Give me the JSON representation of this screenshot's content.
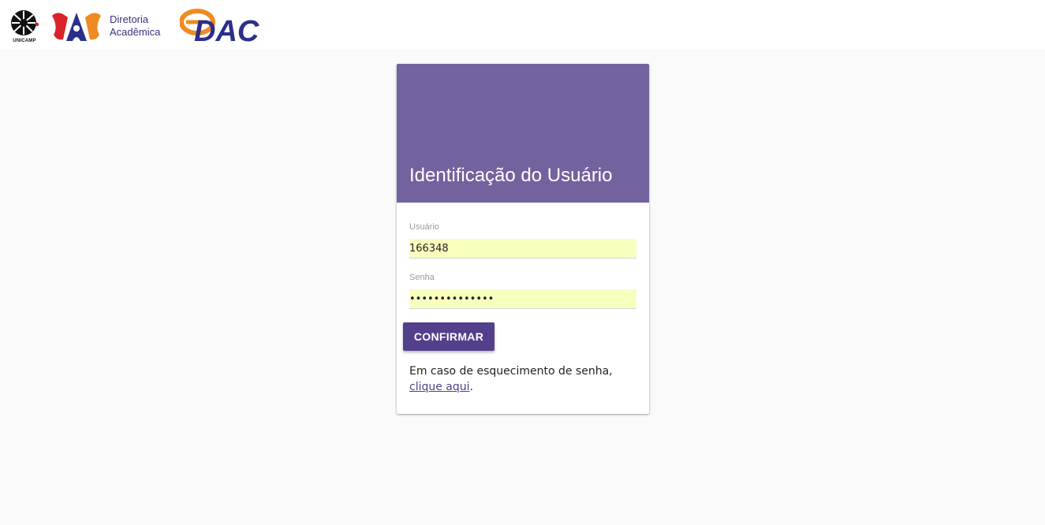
{
  "header": {
    "unicamp_logo_text": "UNICAMP",
    "dac_line1": "Diretoria",
    "dac_line2": "Acadêmica",
    "edac_logo_text": "DAC"
  },
  "card": {
    "title": "Identificação do Usuário",
    "username_label": "Usuário",
    "username_value": "166348",
    "password_label": "Senha",
    "password_value": "••••••••••••••",
    "confirm_label": "CONFIRMAR",
    "forgot_text": "Em caso de esquecimento de senha,",
    "forgot_link": "clique aqui",
    "forgot_end": "."
  },
  "colors": {
    "header_bg": "#72639f",
    "button_bg": "#533f8c",
    "autofill_bg": "#f9ffbd",
    "page_bg": "#fafafa"
  }
}
